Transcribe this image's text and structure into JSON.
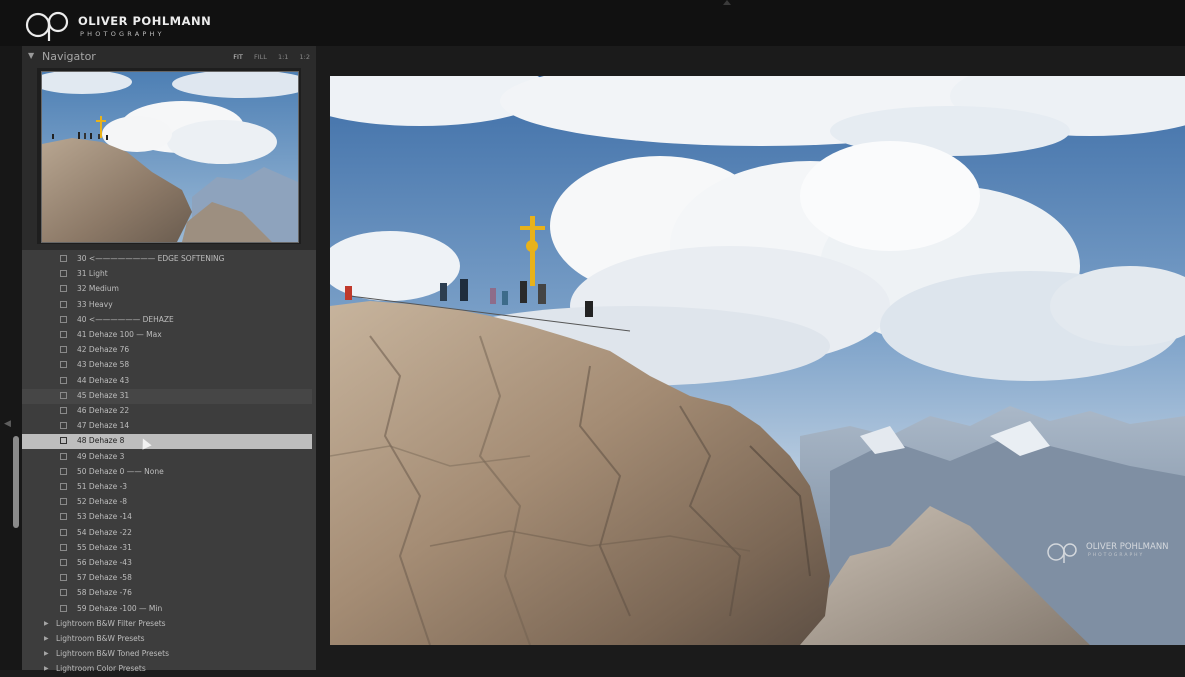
{
  "brand": {
    "name": "OLIVER POHLMANN",
    "sub": "PHOTOGRAPHY"
  },
  "navigator": {
    "title": "Navigator",
    "zoom_options": [
      "FIT",
      "FILL",
      "1:1",
      "1:2"
    ],
    "selected_zoom": "FIT"
  },
  "presets": {
    "items": [
      {
        "label": "30 <———————— EDGE SOFTENING",
        "state": "normal"
      },
      {
        "label": "31 Light",
        "state": "normal"
      },
      {
        "label": "32 Medium",
        "state": "normal"
      },
      {
        "label": "33 Heavy",
        "state": "normal"
      },
      {
        "label": "40 <—————— DEHAZE",
        "state": "normal"
      },
      {
        "label": "41 Dehaze 100 — Max",
        "state": "normal"
      },
      {
        "label": "42 Dehaze 76",
        "state": "normal"
      },
      {
        "label": "43 Dehaze 58",
        "state": "normal"
      },
      {
        "label": "44 Dehaze 43",
        "state": "normal"
      },
      {
        "label": "45 Dehaze 31",
        "state": "hover"
      },
      {
        "label": "46 Dehaze 22",
        "state": "normal"
      },
      {
        "label": "47 Dehaze 14",
        "state": "normal"
      },
      {
        "label": "48 Dehaze 8",
        "state": "selected"
      },
      {
        "label": "49 Dehaze 3",
        "state": "normal"
      },
      {
        "label": "50 Dehaze 0 —— None",
        "state": "normal"
      },
      {
        "label": "51 Dehaze -3",
        "state": "normal"
      },
      {
        "label": "52 Dehaze -8",
        "state": "normal"
      },
      {
        "label": "53 Dehaze -14",
        "state": "normal"
      },
      {
        "label": "54 Dehaze -22",
        "state": "normal"
      },
      {
        "label": "55 Dehaze -31",
        "state": "normal"
      },
      {
        "label": "56 Dehaze -43",
        "state": "normal"
      },
      {
        "label": "57 Dehaze -58",
        "state": "normal"
      },
      {
        "label": "58 Dehaze -76",
        "state": "normal"
      },
      {
        "label": "59 Dehaze -100 — Min",
        "state": "normal"
      }
    ],
    "folders": [
      {
        "label": "Lightroom B&W Filter Presets"
      },
      {
        "label": "Lightroom B&W Presets"
      },
      {
        "label": "Lightroom B&W Toned Presets"
      },
      {
        "label": "Lightroom Color Presets"
      }
    ]
  },
  "watermark": {
    "name": "OLIVER POHLMANN",
    "sub": "PHOTOGRAPHY"
  },
  "colors": {
    "panel": "#3d3d3d",
    "selected_row": "#bdbdbd",
    "topbar": "#111111",
    "cross": "#e8b21a"
  }
}
